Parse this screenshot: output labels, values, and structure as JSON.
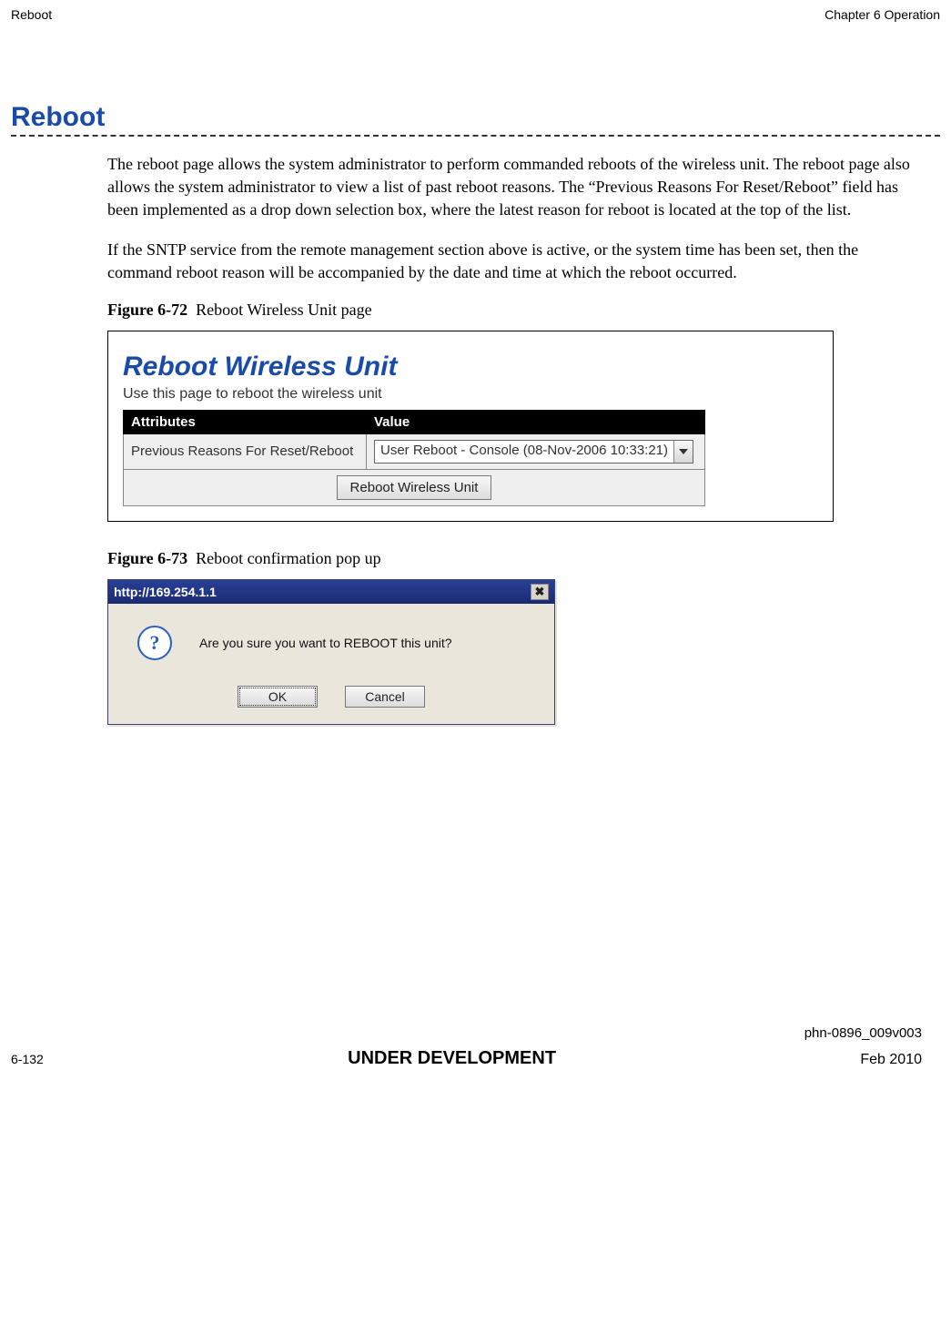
{
  "header": {
    "left": "Reboot",
    "right": "Chapter 6 Operation"
  },
  "section_title": "Reboot",
  "paragraphs": {
    "p1": "The reboot page allows the system administrator to perform commanded reboots of the wireless unit. The reboot page also allows the system administrator to view a list of past reboot reasons. The “Previous Reasons For Reset/Reboot” field has been implemented as a drop down selection box, where the latest reason for reboot is located at the top of the list.",
    "p2": "If the SNTP service from the remote management section above is active, or the system time has been set, then the command reboot reason will be accompanied by the date and time at which the reboot occurred."
  },
  "figure1": {
    "label": "Figure 6-72",
    "caption": "Reboot Wireless Unit page"
  },
  "reboot_panel": {
    "title": "Reboot Wireless Unit",
    "subtitle": "Use this page to reboot the wireless unit",
    "col_attr": "Attributes",
    "col_val": "Value",
    "row_label": "Previous Reasons For Reset/Reboot",
    "select_value": "User Reboot - Console (08-Nov-2006 10:33:21)",
    "button": "Reboot Wireless Unit"
  },
  "figure2": {
    "label": "Figure 6-73",
    "caption": "Reboot confirmation pop up"
  },
  "dialog": {
    "title": "http://169.254.1.1",
    "close": "✖",
    "icon": "?",
    "message": "Are you sure you want to REBOOT this unit?",
    "ok": "OK",
    "cancel": "Cancel"
  },
  "footer": {
    "doc": "phn-0896_009v003",
    "page": "6-132",
    "status": "UNDER DEVELOPMENT",
    "date": "Feb 2010"
  }
}
